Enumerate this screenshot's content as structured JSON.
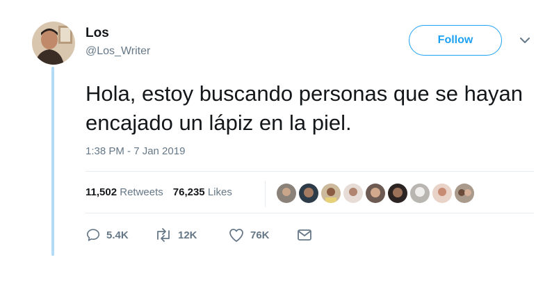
{
  "user": {
    "name": "Los",
    "handle": "@Los_Writer"
  },
  "follow_label": "Follow",
  "tweet": {
    "text": "Hola, estoy buscando personas que se hayan encajado un lápiz en la piel.",
    "timestamp": "1:38 PM - 7 Jan 2019"
  },
  "stats": {
    "retweets_count": "11,502",
    "retweets_label": "Retweets",
    "likes_count": "76,235",
    "likes_label": "Likes"
  },
  "actions": {
    "replies": "5.4K",
    "retweets": "12K",
    "likes": "76K"
  },
  "colors": {
    "accent": "#1da1f2",
    "secondary_text": "#657786",
    "thread_line": "#b3dbf5"
  },
  "icons": [
    "reply-icon",
    "retweet-icon",
    "like-icon",
    "direct-message-icon",
    "chevron-down-icon"
  ]
}
